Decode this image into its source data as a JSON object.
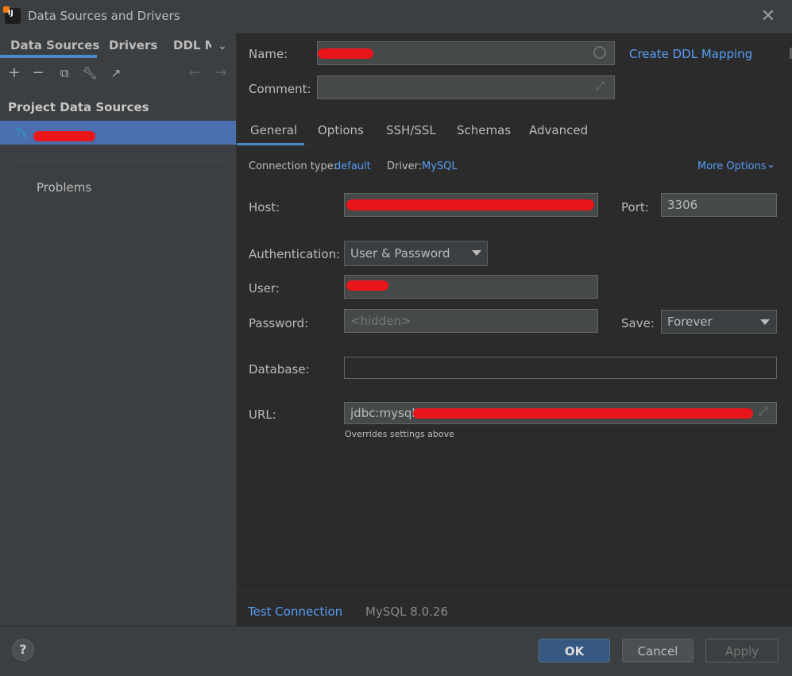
{
  "window": {
    "title": "Data Sources and Drivers"
  },
  "left": {
    "tabs": [
      "Data Sources",
      "Drivers",
      "DDL M"
    ],
    "section_title": "Project Data Sources",
    "problems_label": "Problems"
  },
  "form": {
    "name_label": "Name:",
    "comment_label": "Comment:",
    "create_ddl_link": "Create DDL Mapping",
    "tabs": [
      "General",
      "Options",
      "SSH/SSL",
      "Schemas",
      "Advanced"
    ],
    "connection_type_label": "Connection type:",
    "connection_type_value": "default",
    "driver_label": "Driver:",
    "driver_value": "MySQL",
    "more_options": "More Options",
    "host_label": "Host:",
    "port_label": "Port:",
    "port_value": "3306",
    "auth_label": "Authentication:",
    "auth_value": "User & Password",
    "user_label": "User:",
    "password_label": "Password:",
    "password_placeholder": "<hidden>",
    "save_label": "Save:",
    "save_value": "Forever",
    "database_label": "Database:",
    "url_label": "URL:",
    "url_prefix": "jdbc:mysql://",
    "overrides_note": "Overrides settings above"
  },
  "bottom": {
    "test_connection": "Test Connection",
    "server_version": "MySQL 8.0.26"
  },
  "footer": {
    "help": "?",
    "ok": "OK",
    "cancel": "Cancel",
    "apply": "Apply"
  }
}
